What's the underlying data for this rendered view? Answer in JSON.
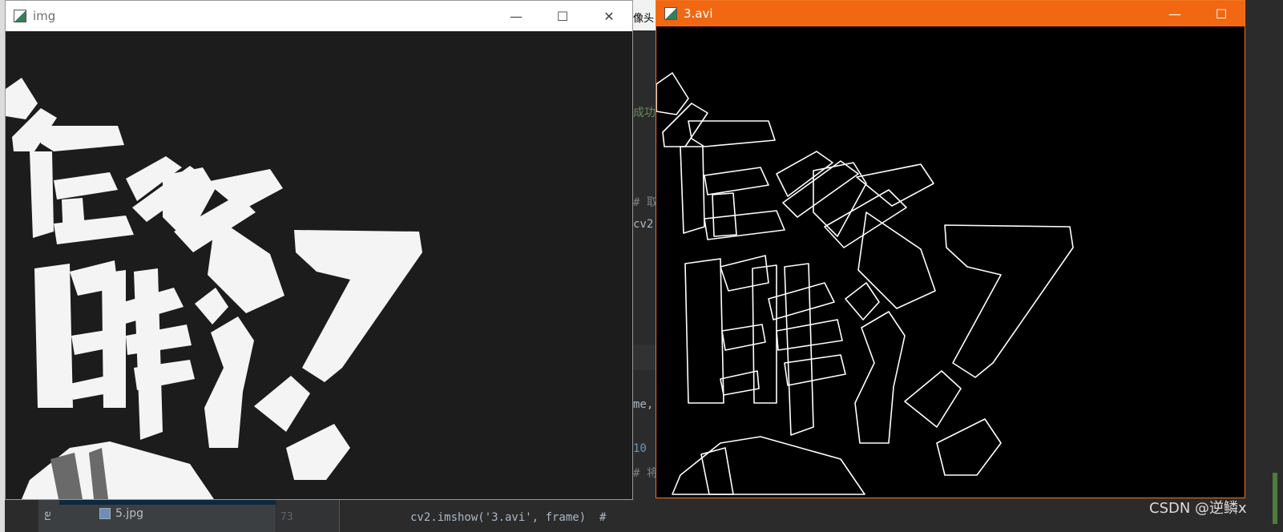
{
  "background_ide": {
    "sidebar_label": "re",
    "file_item": "5.jpg",
    "line_number": "73",
    "code_fragments": {
      "cn_top": "像头",
      "cn_success": "成功",
      "comment_take": "# 取",
      "cv2_prefix": "cv2.",
      "me_comma": "me,",
      "num_10": "10",
      "comment_will": "# 将",
      "imshow_line": "cv2.imshow('3.avi', frame)  #"
    }
  },
  "windows": [
    {
      "id": "img",
      "title": "img",
      "controls": {
        "minimize": "—",
        "maximize": "☐",
        "close": "✕"
      },
      "content": "grayscale-thresholded-calligraphy-image"
    },
    {
      "id": "avi",
      "title": "3.avi",
      "controls": {
        "minimize": "—",
        "maximize": "☐"
      },
      "content": "edge-detected-calligraphy-frame"
    }
  ],
  "watermark": "CSDN @逆鳞x",
  "colors": {
    "ide_bg": "#2b2b2b",
    "avi_titlebar": "#f26711",
    "img_titlebar": "#ffffff",
    "img_canvas": "#1c1c1c",
    "avi_canvas": "#000000"
  }
}
